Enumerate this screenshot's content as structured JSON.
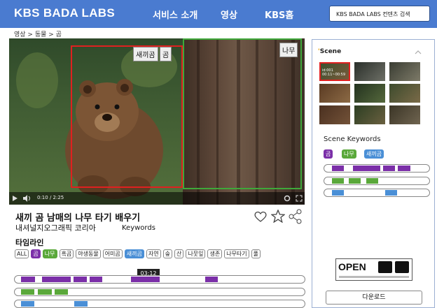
{
  "header": {
    "brand": "KBS BADA LABS",
    "nav": [
      "서비스 소개",
      "영상",
      "KBS홈"
    ],
    "search_placeholder": "KBS BADA LABS 컨텐츠 검색"
  },
  "breadcrumb": "영상 > 동물 > 곰",
  "video": {
    "box_labels": [
      "새끼곰",
      "곰",
      "나무"
    ],
    "time": "0:10 / 2:25"
  },
  "info": {
    "title": "새끼 곰 남매의 나무 타기 배우기",
    "subtitle": "내셔널지오그래픽 코리아",
    "keywords_label": "Keywords"
  },
  "timeline": {
    "heading": "타임라인",
    "tags": [
      {
        "label": "ALL",
        "state": "plain"
      },
      {
        "label": "곰",
        "state": "purple"
      },
      {
        "label": "나무",
        "state": "green"
      },
      {
        "label": "흑곰",
        "state": "plain"
      },
      {
        "label": "야생동물",
        "state": "plain"
      },
      {
        "label": "어미곰",
        "state": "plain"
      },
      {
        "label": "새끼곰",
        "state": "blue"
      },
      {
        "label": "자연",
        "state": "plain"
      },
      {
        "label": "숲",
        "state": "plain"
      },
      {
        "label": "산",
        "state": "plain"
      },
      {
        "label": "나뭇잎",
        "state": "plain"
      },
      {
        "label": "생존",
        "state": "plain"
      },
      {
        "label": "나무타기",
        "state": "plain"
      },
      {
        "label": "풀",
        "state": "plain"
      }
    ],
    "tooltip": "03:12"
  },
  "scene": {
    "title": "Scene",
    "thumb_label": "id:001\n00:11~00:59",
    "keywords_title": "Scene Keywords",
    "tags": [
      "곰",
      "나무",
      "새끼곰"
    ]
  },
  "license": {
    "open_text": "OPEN"
  },
  "download_label": "다운로드",
  "colors": {
    "header": "#4a7bd0",
    "purple": "#7b2fa8",
    "green": "#5aa83a",
    "blue": "#4a8fd6"
  }
}
